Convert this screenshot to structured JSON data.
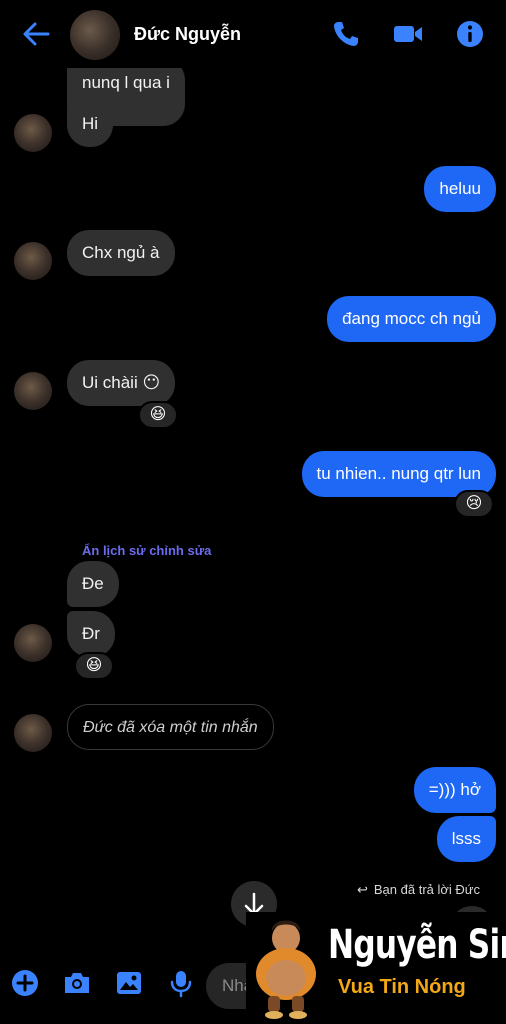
{
  "header": {
    "contact_name": "Đức Nguyễn",
    "icons": [
      "back-arrow-icon",
      "phone-icon",
      "video-call-icon",
      "info-icon"
    ],
    "accent_color": "#1f67f5"
  },
  "messages": {
    "m0": "nunq l qua i",
    "m1": "Hi",
    "m2": "heluu",
    "m3": "Chx ngủ à",
    "m4": "đang mocc ch ngủ",
    "m5": "Ui chàii 😶",
    "m5_reaction": "😆",
    "m6": "tu nhien.. nung qtr lun",
    "m6_reaction": "😢",
    "edit_note": "Ẩn lịch sử chỉnh sửa",
    "m7": "Đe",
    "m8": "Đr",
    "m8_reaction": "😆",
    "m9": "Đức đã xóa một tin nhắn",
    "m10": "=))) hở",
    "m11": "lsss",
    "reply_note": "Bạn đã trả lời Đức"
  },
  "composer": {
    "placeholder": "Nhắn tin",
    "icons": [
      "add-icon",
      "camera-icon",
      "gallery-icon",
      "microphone-icon"
    ]
  },
  "watermark": {
    "title": "Nguyễn Sin",
    "subtitle": "Vua Tin Nóng"
  }
}
